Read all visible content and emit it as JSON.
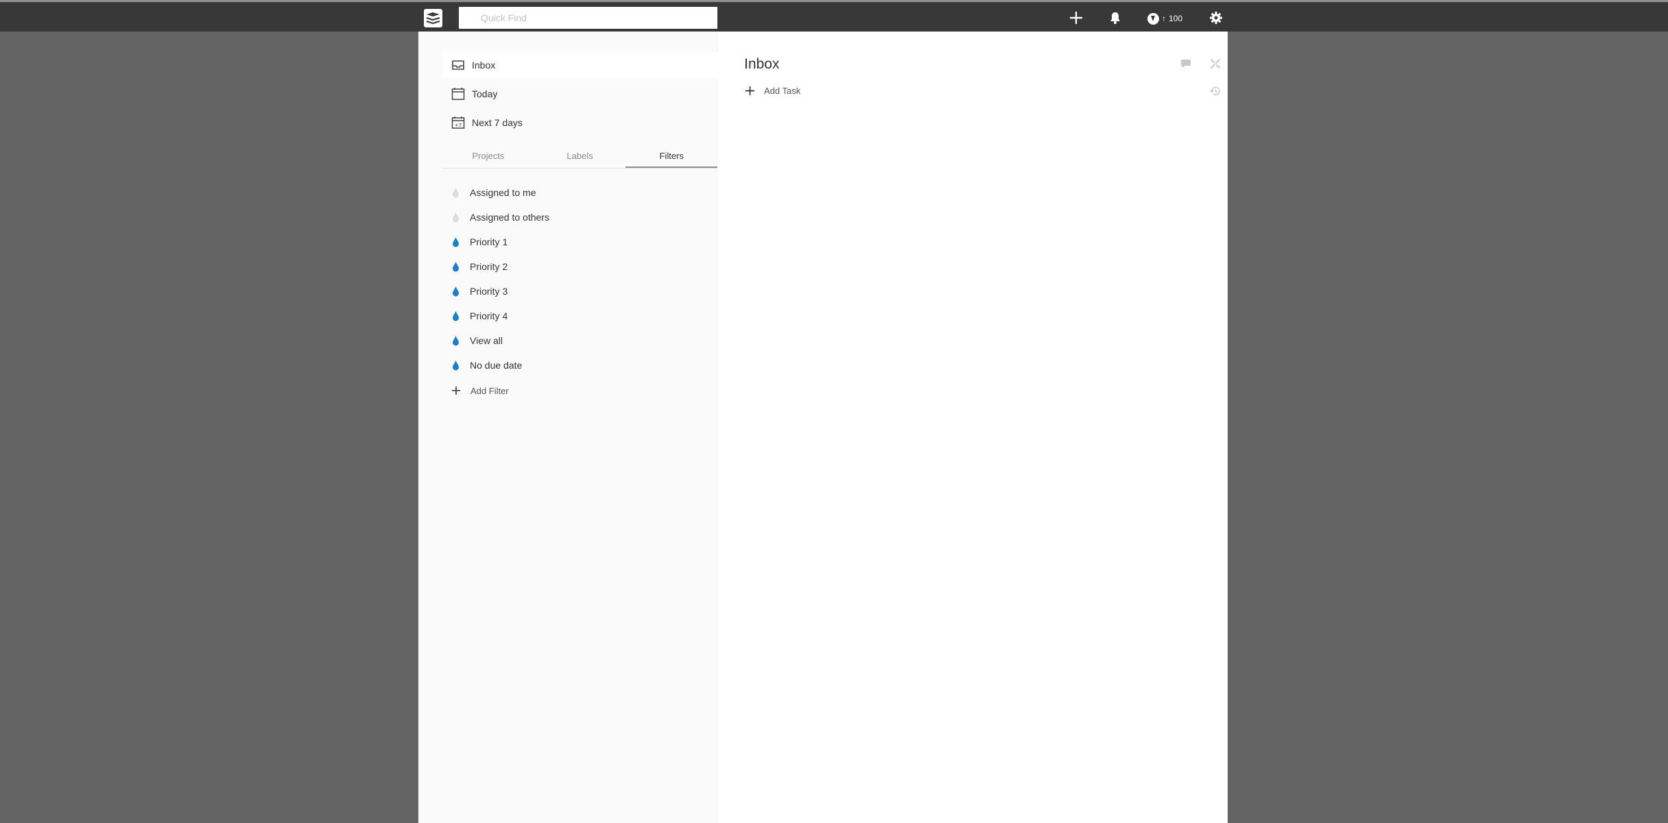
{
  "search": {
    "placeholder": "Quick Find",
    "value": ""
  },
  "topbar": {
    "karma": "100"
  },
  "nav": [
    {
      "label": "Inbox",
      "icon": "inbox-icon"
    },
    {
      "label": "Today",
      "icon": "calendar-icon"
    },
    {
      "label": "Next 7 days",
      "icon": "calendar-plus7-icon",
      "badge": "+7"
    }
  ],
  "tabs": [
    "Projects",
    "Labels",
    "Filters"
  ],
  "active_tab": "Filters",
  "filters": [
    {
      "label": "Assigned to me",
      "color": "#dddddd"
    },
    {
      "label": "Assigned to others",
      "color": "#dddddd"
    },
    {
      "label": "Priority 1",
      "color": "#1d7fc6"
    },
    {
      "label": "Priority 2",
      "color": "#1d7fc6"
    },
    {
      "label": "Priority 3",
      "color": "#1d7fc6"
    },
    {
      "label": "Priority 4",
      "color": "#1d7fc6"
    },
    {
      "label": "View all",
      "color": "#1d7fc6"
    },
    {
      "label": "No due date",
      "color": "#1d7fc6"
    }
  ],
  "add_filter_label": "Add Filter",
  "main": {
    "title": "Inbox",
    "add_task_label": "Add Task"
  },
  "colors": {
    "topbar": "#383838",
    "background": "#646464",
    "accent": "#1d7fc6"
  }
}
